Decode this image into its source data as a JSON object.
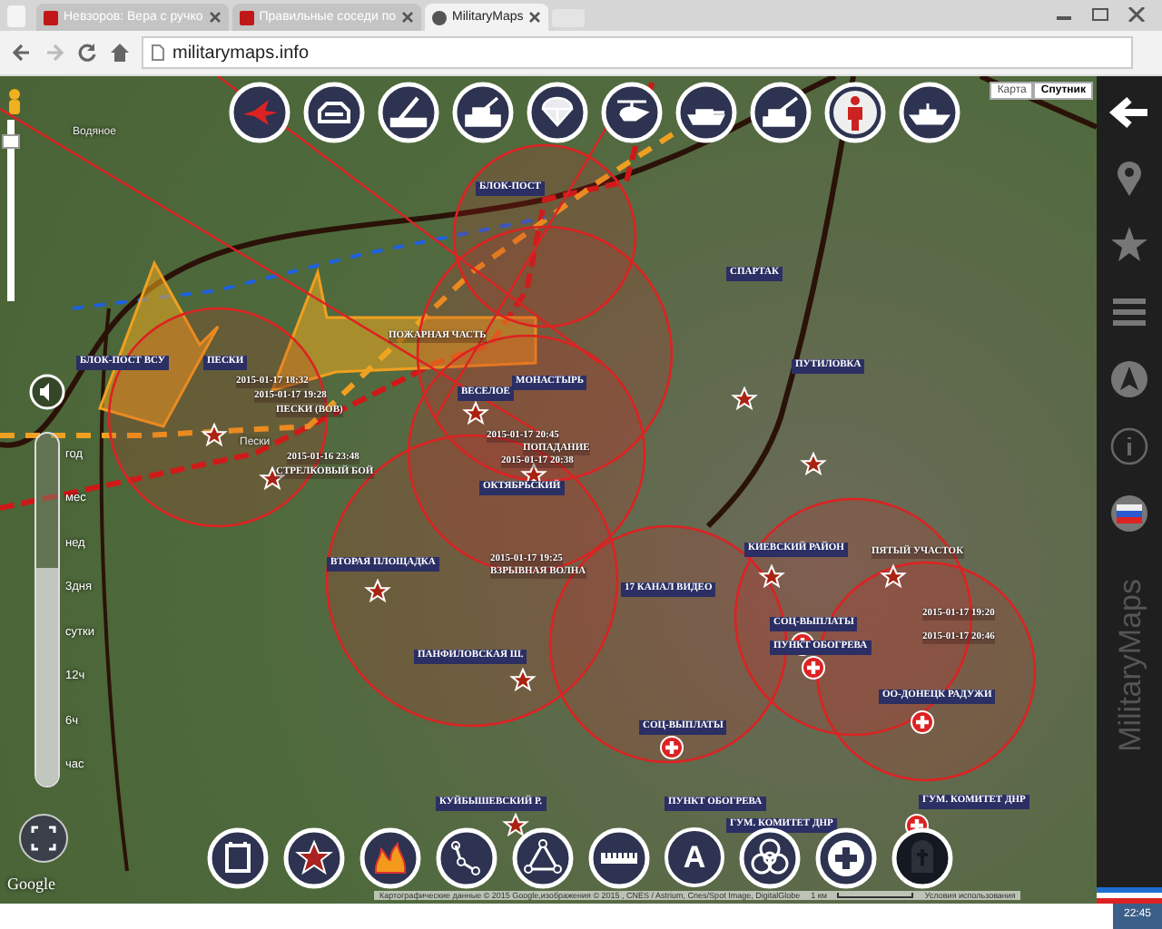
{
  "browser": {
    "tabs": [
      {
        "title": "Невзоров: Вера с ручко",
        "selected": false
      },
      {
        "title": "Правильные соседи по",
        "selected": false
      },
      {
        "title": "MilitaryMaps",
        "selected": true
      }
    ],
    "address": "militarymaps.info"
  },
  "map": {
    "type_buttons": [
      {
        "label": "Карта",
        "selected": false
      },
      {
        "label": "Спутник",
        "selected": true
      }
    ],
    "unit_toolbar": [
      {
        "kind": "jet"
      },
      {
        "kind": "apc"
      },
      {
        "kind": "launcher"
      },
      {
        "kind": "spg"
      },
      {
        "kind": "parachute"
      },
      {
        "kind": "helicopter"
      },
      {
        "kind": "tank"
      },
      {
        "kind": "artillery"
      },
      {
        "kind": "soldier"
      },
      {
        "kind": "ship"
      }
    ],
    "labels": [
      {
        "kind": "place",
        "text": "Водяное"
      },
      {
        "kind": "tag",
        "text": "БЛОК-ПОСТ ВСУ"
      },
      {
        "kind": "tag",
        "text": "ПЕСКИ"
      },
      {
        "kind": "event",
        "text": "2015-01-17 18:32"
      },
      {
        "kind": "event",
        "text": "2015-01-17 19:28"
      },
      {
        "kind": "event",
        "text": "ПЕСКИ (ВОВ)"
      },
      {
        "kind": "place",
        "text": "Пески"
      },
      {
        "kind": "event",
        "text": "2015-01-16 23:48"
      },
      {
        "kind": "event",
        "text": "СТРЕЛКОВЫЙ БОЙ"
      },
      {
        "kind": "tag",
        "text": "БЛОК-ПОСТ"
      },
      {
        "kind": "event",
        "text": "ПОЖАРНАЯ ЧАСТЬ"
      },
      {
        "kind": "tag",
        "text": "ВЕСЕЛОЕ"
      },
      {
        "kind": "tag",
        "text": "МОНАСТЫРЬ"
      },
      {
        "kind": "event",
        "text": "2015-01-17 20:45"
      },
      {
        "kind": "event",
        "text": "ПОПАДАНИЕ"
      },
      {
        "kind": "event",
        "text": "2015-01-17 20:38"
      },
      {
        "kind": "tag",
        "text": "ОКТЯБРЬСКИЙ"
      },
      {
        "kind": "tag",
        "text": "СПАРТАК"
      },
      {
        "kind": "tag",
        "text": "ПУТИЛОВКА"
      },
      {
        "kind": "tag",
        "text": "ВТОРАЯ ПЛОЩАДКА"
      },
      {
        "kind": "event",
        "text": "2015-01-17 19:25"
      },
      {
        "kind": "event",
        "text": "ВЗРЫВНАЯ ВОЛНА"
      },
      {
        "kind": "tag",
        "text": "17 КАНАЛ ВИДЕО"
      },
      {
        "kind": "tag",
        "text": "КИЕВСКИЙ РАЙОН"
      },
      {
        "kind": "event",
        "text": "ПЯТЫЙ УЧАСТОК"
      },
      {
        "kind": "tag",
        "text": "ПАНФИЛОВСКАЯ Ш."
      },
      {
        "kind": "tag",
        "text": "СОЦ-ВЫПЛАТЫ"
      },
      {
        "kind": "tag",
        "text": "ПУНКТ ОБОГРЕВА"
      },
      {
        "kind": "event",
        "text": "2015-01-17 19:20"
      },
      {
        "kind": "event",
        "text": "2015-01-17 20:46"
      },
      {
        "kind": "tag",
        "text": "ОО-ДОНЕЦК РАДУЖИ"
      },
      {
        "kind": "tag",
        "text": "СОЦ-ВЫПЛАТЫ"
      },
      {
        "kind": "tag",
        "text": "КУЙБЫШЕВСКИЙ Р."
      },
      {
        "kind": "tag",
        "text": "ПУНКТ ОБОГРЕВА"
      },
      {
        "kind": "tag",
        "text": "ГУМ. КОМИТЕТ ДНР"
      },
      {
        "kind": "tag",
        "text": "ГУМ. КОМИТЕТ ДНР"
      }
    ],
    "zoom": {
      "level": 0.9
    },
    "time_range": {
      "level": 0.62
    },
    "time_scale": [
      "год",
      "мес",
      "нед",
      "3дня",
      "сутки",
      "12ч",
      "6ч",
      "час"
    ],
    "draw_toolbar": [
      {
        "kind": "calendar"
      },
      {
        "kind": "star"
      },
      {
        "kind": "fire"
      },
      {
        "kind": "path"
      },
      {
        "kind": "triangle"
      },
      {
        "kind": "ruler"
      },
      {
        "kind": "text",
        "label": "A"
      },
      {
        "kind": "biohazard"
      },
      {
        "kind": "plus"
      },
      {
        "kind": "grave"
      }
    ],
    "logo": "Google",
    "attribution": "Картографические данные © 2015 Google,изображения © 2015 , CNES / Astrium, Cnes/Spot Image, DigitalGlobe",
    "scale": "1 км",
    "terms": "Условия использования"
  },
  "sidebar": {
    "icons": [
      {
        "kind": "pin"
      },
      {
        "kind": "star"
      },
      {
        "kind": "menu"
      },
      {
        "kind": "navigate"
      },
      {
        "kind": "info"
      },
      {
        "kind": "flag"
      }
    ],
    "brand": "MilitaryMaps"
  },
  "taskbar": {
    "time": "22:45"
  }
}
